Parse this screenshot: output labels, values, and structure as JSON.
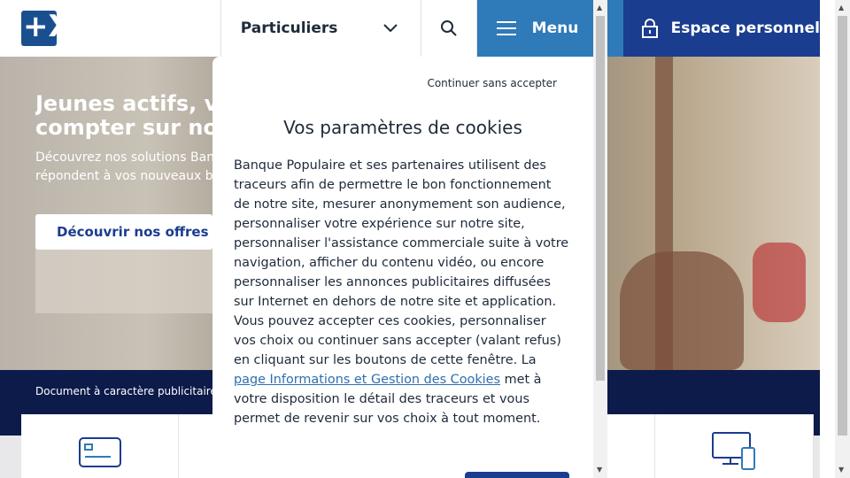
{
  "header": {
    "logo_text": "+X",
    "segment_label": "Particuliers",
    "menu_label": "Menu",
    "espace_label": "Espace personnel"
  },
  "hero": {
    "title_line1": "Jeunes actifs, vous pouvez",
    "title_line2": "compter sur nous",
    "text_line1": "Découvrez nos solutions Banque Populaire qui",
    "text_line2": "répondent à vos nouveaux besoins",
    "cta_label": "Découvrir nos offres"
  },
  "band": {
    "disclaimer": "Document à caractère publicitaire"
  },
  "modal": {
    "skip_label": "Continuer sans accepter",
    "title": "Vos paramètres de cookies",
    "body_before_link": "Banque Populaire et ses partenaires utilisent des traceurs afin de permettre le bon fonctionnement de notre site, mesurer anonymement son audience, personnaliser votre expérience sur notre site, personnaliser l'assistance commerciale suite à votre navigation, afficher du contenu vidéo, ou encore personnaliser les annonces publicitaires diffusées sur Internet en dehors de notre site et application. Vous pouvez accepter ces cookies, personnaliser vos choix ou continuer sans accepter (valant refus) en cliquant sur les boutons de cette fenêtre. La ",
    "link_text": "page Informations et Gestion des Cookies",
    "body_after_link": " met à votre disposition le détail des traceurs et vous permet de revenir sur vos choix à tout moment."
  },
  "colors": {
    "brand_blue": "#1a3d8f",
    "menu_blue": "#2f7ab8",
    "band_navy": "#0c1b4a",
    "link_blue": "#2f6fb0"
  },
  "icons": {
    "segment": "chevron-down-icon",
    "search": "search-icon",
    "menu": "hamburger-icon",
    "espace": "lock-icon",
    "card1": "card-icon",
    "card4": "devices-icon"
  }
}
